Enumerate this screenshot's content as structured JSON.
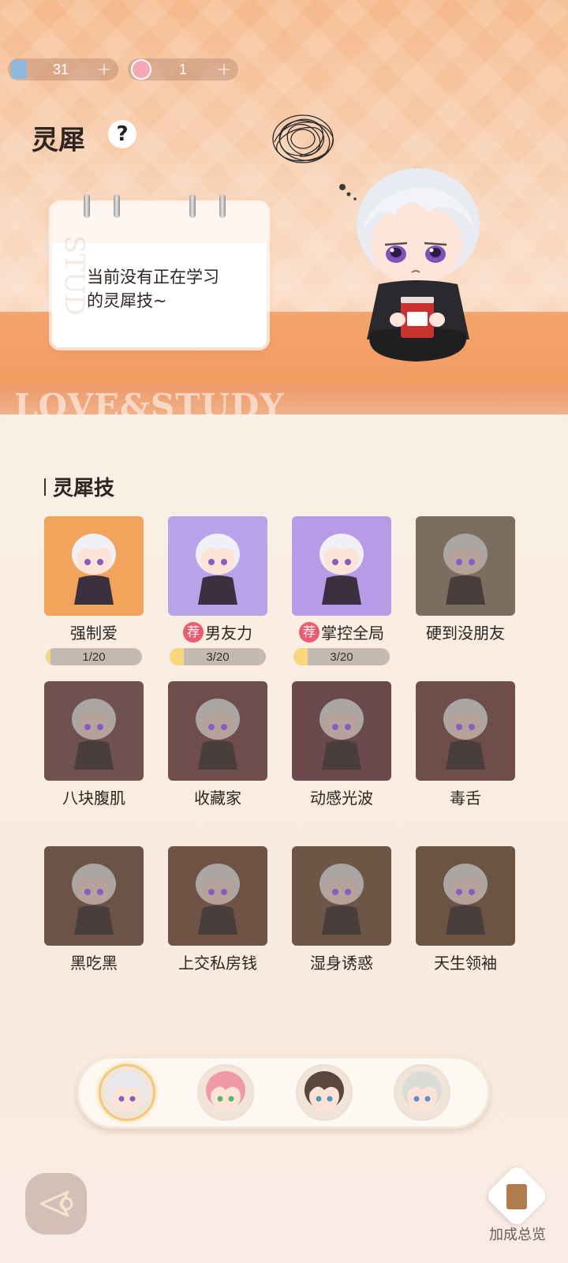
{
  "currencies": [
    {
      "icon": "book-ticket-icon",
      "value": "31"
    },
    {
      "icon": "pink-token-icon",
      "value": "1"
    }
  ],
  "title": "灵犀",
  "help_icon_label": "?",
  "notebook": {
    "message": "当前没有正在学习的灵犀技~",
    "watermark": "STUD"
  },
  "banner_text": "LOVE&STUDY",
  "section_title": "灵犀技",
  "skills": [
    {
      "name": "强制爱",
      "recommended": false,
      "progress": "1/20",
      "progress_value": 0.05,
      "unlocked": true,
      "bg": "#f2a45c"
    },
    {
      "name": "男友力",
      "recommended": true,
      "tag": "荐",
      "progress": "3/20",
      "progress_value": 0.15,
      "unlocked": true,
      "bg": "#b9a3e8"
    },
    {
      "name": "掌控全局",
      "recommended": true,
      "tag": "荐",
      "progress": "3/20",
      "progress_value": 0.15,
      "unlocked": true,
      "bg": "#b79be6"
    },
    {
      "name": "硬到没朋友",
      "recommended": false,
      "unlocked": false,
      "bg": "#7c6e5e"
    },
    {
      "name": "八块腹肌",
      "recommended": false,
      "unlocked": false,
      "bg": "#6f5150"
    },
    {
      "name": "收藏家",
      "recommended": false,
      "unlocked": false,
      "bg": "#6f4d4c"
    },
    {
      "name": "动感光波",
      "recommended": false,
      "unlocked": false,
      "bg": "#6a4a4c"
    },
    {
      "name": "毒舌",
      "recommended": false,
      "unlocked": false,
      "bg": "#6f4d4a"
    },
    {
      "name": "黑吃黑",
      "recommended": false,
      "unlocked": false,
      "bg": "#6b5445"
    },
    {
      "name": "上交私房钱",
      "recommended": false,
      "unlocked": false,
      "bg": "#6f5345"
    },
    {
      "name": "湿身诱惑",
      "recommended": false,
      "unlocked": false,
      "bg": "#6e5647"
    },
    {
      "name": "天生领袖",
      "recommended": false,
      "unlocked": false,
      "bg": "#6c5443"
    }
  ],
  "characters": [
    {
      "name": "white-hair-avatar",
      "active": true,
      "hair": "#e7e7ee",
      "eye": "#8a5cc2"
    },
    {
      "name": "pink-hair-avatar",
      "active": false,
      "hair": "#f09aa6",
      "eye": "#5bb46b"
    },
    {
      "name": "brown-hair-avatar",
      "active": false,
      "hair": "#5a463e",
      "eye": "#4a9bb7"
    },
    {
      "name": "silver-hair-avatar",
      "active": false,
      "hair": "#dcdcd6",
      "eye": "#5b8fd0"
    }
  ],
  "bonus_button_label": "加成总览"
}
